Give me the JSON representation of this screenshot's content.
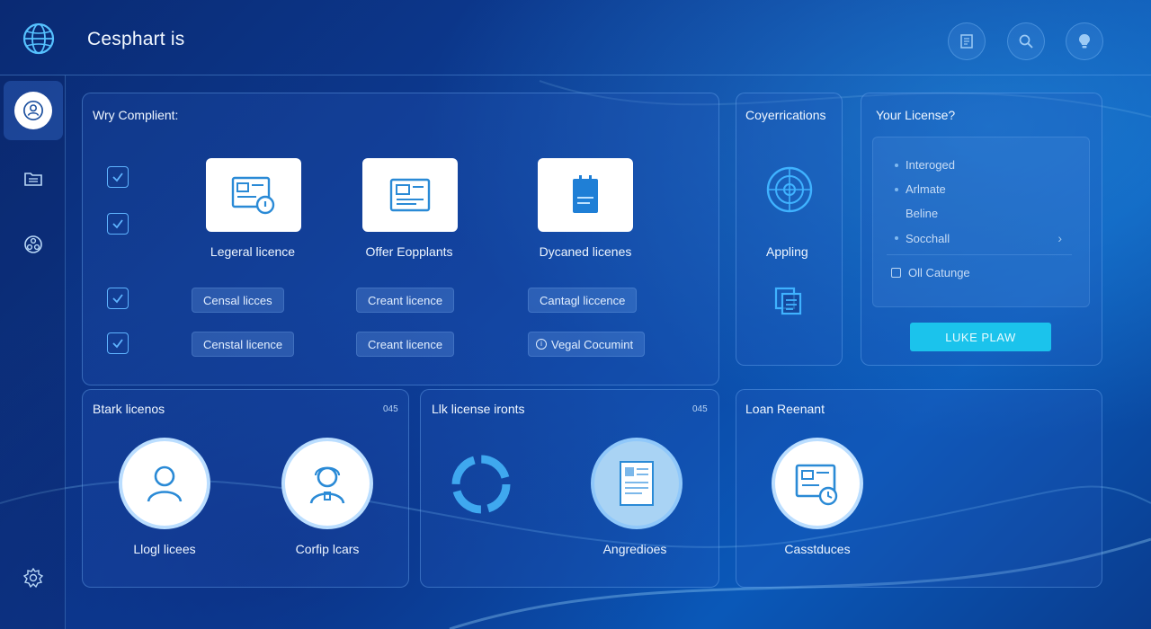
{
  "header": {
    "app_title": "Cesphart is",
    "icons": [
      "logo-globe-icon",
      "document-icon",
      "search-icon",
      "lightbulb-icon"
    ]
  },
  "sidebar": {
    "icons": [
      "user-icon",
      "folder-icon",
      "network-icon",
      "settings-icon"
    ]
  },
  "compliance": {
    "title": "Wry Complient:",
    "tiles": [
      {
        "label": "Legeral licence",
        "icon": "license-card-icon"
      },
      {
        "label": "Offer Eopplants",
        "icon": "id-card-icon"
      },
      {
        "label": "Dycaned licenes",
        "icon": "clipboard-icon"
      }
    ],
    "chips_row1": [
      "Censal licces",
      "Creant licence",
      "Cantagl liccence"
    ],
    "chips_row2": [
      "Censtal licence",
      "Creant licence",
      "Vegal Cocumint"
    ]
  },
  "certifications": {
    "title": "Coyerrications",
    "label": "Appling"
  },
  "your_license": {
    "title": "Your License?",
    "items": [
      "Interoged",
      "Arlmate",
      "Beline",
      "Socchall"
    ],
    "checkbox_label": "Oll Catunge",
    "cta_label": "LUKE PLAW"
  },
  "stark": {
    "title": "Btark licenos",
    "badge": "045",
    "items": [
      {
        "label": "Llogl licees",
        "icon": "person-icon"
      },
      {
        "label": "Corfip lcars",
        "icon": "support-agent-icon"
      }
    ]
  },
  "link_license": {
    "title": "Llk license ironts",
    "badge": "045",
    "items": [
      {
        "label": "",
        "icon": "sync-arrows-icon"
      },
      {
        "label": "Angredioes",
        "icon": "document-icon"
      }
    ]
  },
  "loan": {
    "title": "Loan Reenant",
    "items": [
      {
        "label": "Casstduces",
        "icon": "certificate-clock-icon"
      }
    ]
  },
  "colors": {
    "background": "#0d3f9a",
    "accent": "#1bc3ec",
    "check": "#5fb4ff"
  }
}
